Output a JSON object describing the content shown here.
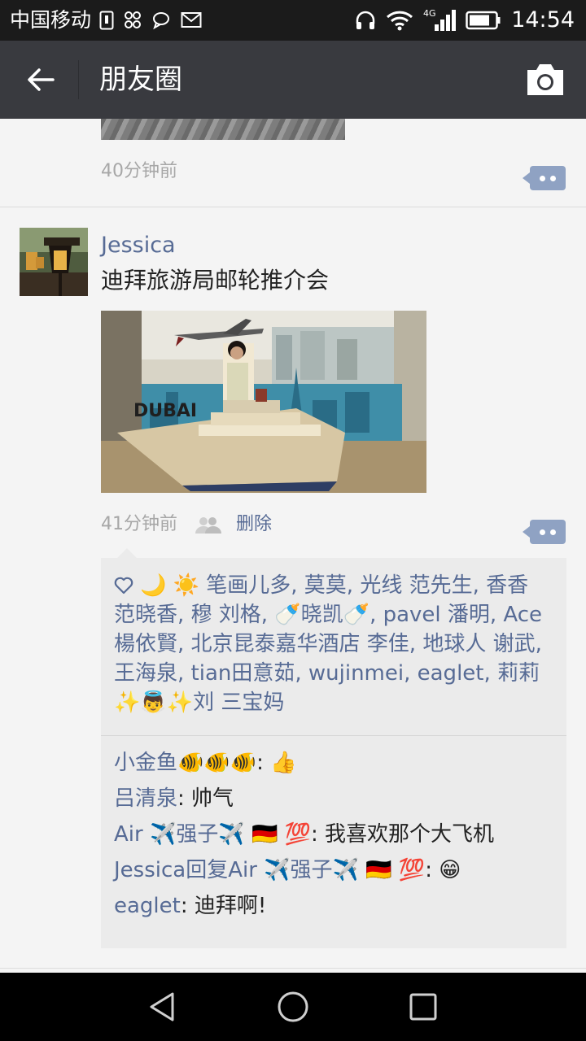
{
  "status_bar": {
    "carrier": "中国移动",
    "network": "4G",
    "time": "14:54"
  },
  "header": {
    "title": "朋友圈",
    "back_icon": "arrow-left-icon",
    "camera_icon": "camera-icon"
  },
  "previous_post": {
    "time": "40分钟前"
  },
  "post": {
    "author": "Jessica",
    "text": "迪拜旅游局邮轮推介会",
    "time": "41分钟前",
    "delete_label": "删除",
    "likes_text": "🌙 ☀️ 笔画儿多, 莫莫, 光线 范先生, 香香 范晓香, 穆 刘格, 🍼晓凯🍼, pavel 潘明, Ace 楊依賢, 北京昆泰嘉华酒店 李佳, 地球人 谢武, 王海泉, tian田意茹, wujinmei, eaglet, 莉莉✨👼✨刘 三宝妈",
    "comments": [
      {
        "user": "小金鱼🐠🐠🐠",
        "text": "👍"
      },
      {
        "user": "吕清泉",
        "text": "帅气"
      },
      {
        "user": "Air ✈️强子✈️ 🇩🇪 💯",
        "text": "我喜欢那个大飞机"
      },
      {
        "user": "Jessica回复Air ✈️强子✈️ 🇩🇪 💯",
        "text": "😁"
      },
      {
        "user": "eaglet",
        "text": "迪拜啊!"
      }
    ]
  },
  "colors": {
    "status_bar": "#1b1b1b",
    "header": "#393a3f",
    "link_blue": "#576b95",
    "comment_button": "#8fa2c3"
  }
}
